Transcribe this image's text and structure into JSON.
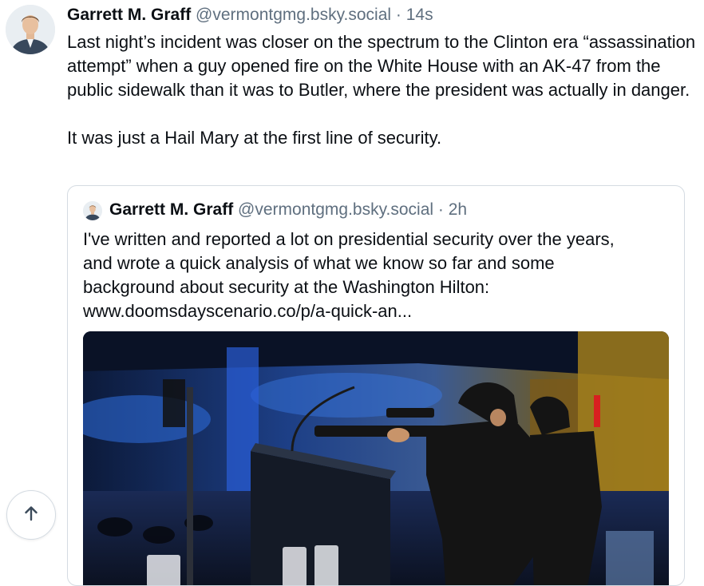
{
  "post": {
    "author_name": "Garrett M. Graff",
    "handle": "@vermontgmg.bsky.social",
    "separator": "·",
    "timestamp": "14s",
    "paragraphs": [
      "Last night’s incident was closer on the spectrum to the Clinton era “assassination attempt” when a guy opened fire on the White House with an AK-47 from the public sidewalk than it was to Butler, where the president was actually in danger.",
      "It was just a Hail Mary at the first line of security."
    ]
  },
  "quoted_post": {
    "author_name": "Garrett M. Graff",
    "handle": "@vermontgmg.bsky.social",
    "separator": "·",
    "timestamp": "2h",
    "lines": [
      "I've written and reported a lot on presidential security over the years,",
      "and wrote a quick analysis of what we know so far and some",
      "background about security at the Washington Hilton:",
      "www.doomsdayscenario.co/p/a-quick-an..."
    ]
  },
  "icons": {
    "scroll_top": "arrow-up-icon"
  },
  "colors": {
    "text": "#0b0f14",
    "muted": "#5f6f7f",
    "border": "#d4dbe2"
  }
}
